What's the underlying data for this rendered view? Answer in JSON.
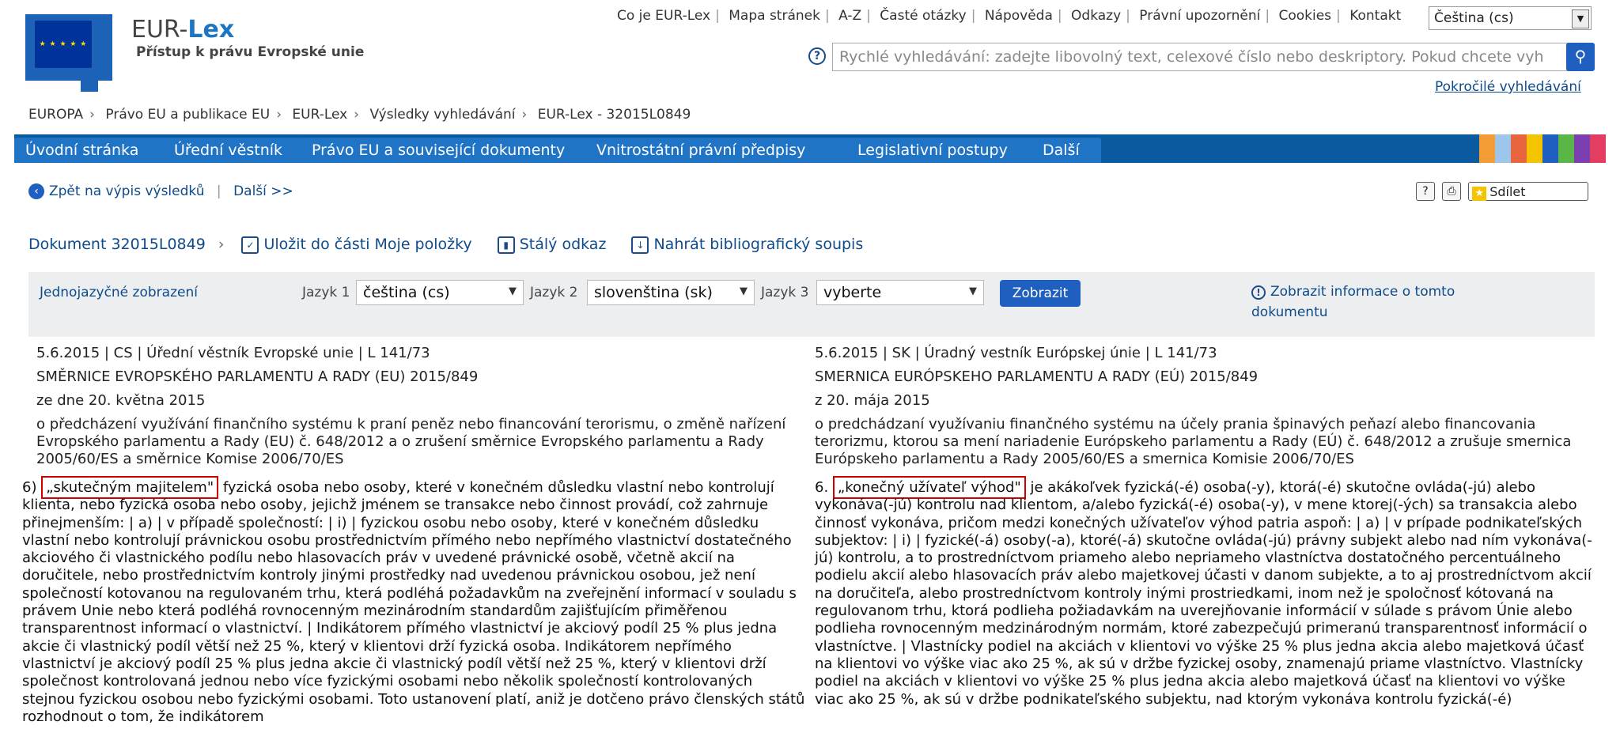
{
  "header": {
    "brand_eur": "EUR-",
    "brand_lex": "Lex",
    "subtitle": "Přístup k právu Evropské unie",
    "top_links": [
      "Co je EUR-Lex",
      "Mapa stránek",
      "A-Z",
      "Časté otázky",
      "Nápověda",
      "Odkazy",
      "Právní upozornění",
      "Cookies",
      "Kontakt"
    ],
    "language": "Čeština (cs)",
    "search_placeholder": "Rychlé vyhledávání: zadejte libovolný text, celexové číslo nebo deskriptory. Pokud chcete vyh",
    "advanced_search": "Pokročilé vyhledávání"
  },
  "breadcrumb": [
    "EUROPA",
    "Právo EU a publikace EU",
    "EUR-Lex",
    "Výsledky vyhledávání",
    "EUR-Lex - 32015L0849"
  ],
  "nav": {
    "tabs": [
      "Úvodní stránka",
      "Úřední věstník",
      "Právo EU a související dokumenty",
      "Vnitrostátní právní předpisy",
      "Legislativní postupy",
      "Další"
    ],
    "color_bars": [
      "#f39c36",
      "#9ec6ea",
      "#e8663d",
      "#f5c400",
      "#1f5fbf",
      "#5ab646",
      "#7c3fb0",
      "#e33d61"
    ]
  },
  "subnav": {
    "back": "Zpět na výpis výsledků",
    "next": "Další >>",
    "share": "Sdílet"
  },
  "doc": {
    "id": "Dokument 32015L0849",
    "save": "Uložit do části Moje položky",
    "permalink": "Stálý odkaz",
    "download_biblio": "Nahrát bibliografický soupis"
  },
  "langbar": {
    "monolingual": "Jednojazyčné zobrazení",
    "lang1_label": "Jazyk 1",
    "lang1_value": "čeština (cs)",
    "lang2_label": "Jazyk 2",
    "lang2_value": "slovenština (sk)",
    "lang3_label": "Jazyk 3",
    "lang3_value": "vyberte",
    "show": "Zobrazit",
    "info": "Zobrazit informace o tomto dokumentu"
  },
  "cs": {
    "meta": "5.6.2015   | CS | Úřední věstník Evropské unie | L 141/73",
    "title": "SMĚRNICE EVROPSKÉHO PARLAMENTU A RADY (EU) 2015/849",
    "date": "ze dne 20. května 2015",
    "subject": "o předcházení využívání finančního systému k praní peněz nebo financování terorismu, o změně nařízení Evropského parlamentu a Rady (EU) č. 648/2012 a o zrušení směrnice Evropského parlamentu a Rady 2005/60/ES a směrnice Komise 2006/70/ES",
    "body_num": "6) ",
    "body_term": "„skutečným majitelem\"",
    "body_rest": " fyzická osoba nebo osoby, které v konečném důsledku vlastní nebo kontrolují klienta, nebo fyzická osoba nebo osoby, jejichž jménem se transakce nebo činnost provádí, což zahrnuje přinejmenším: | a) | v případě společností: | i) | fyzickou osobu nebo osoby, které v konečném důsledku vlastní nebo kontrolují právnickou osobu prostřednictvím přímého nebo nepřímého vlastnictví dostatečného akciového či vlastnického podílu nebo hlasovacích práv v uvedené právnické osobě, včetně akcií na doručitele, nebo prostřednictvím kontroly jinými prostředky nad uvedenou právnickou osobou, jež není společností kotovanou na regulovaném trhu, která podléhá požadavkům na zveřejnění informací v souladu s právem Unie nebo která podléhá rovnocenným mezinárodním standardům zajišťujícím přiměřenou transparentnost informací o vlastnictví. | Indikátorem přímého vlastnictví je akciový podíl 25 % plus jedna akcie či vlastnický podíl větší než 25 %, který v klientovi drží fyzická osoba. Indikátorem nepřímého vlastnictví je akciový podíl 25 % plus jedna akcie či vlastnický podíl větší než 25 %, který v klientovi drží společnost kontrolovaná jednou nebo více fyzickými osobami nebo několik společností kontrolovaných stejnou fyzickou osobou nebo fyzickými osobami. Toto ustanovení platí, aniž je dotčeno právo členských států rozhodnout o tom, že indikátorem"
  },
  "sk": {
    "meta": "5.6.2015   | SK | Úradný vestník Európskej únie | L 141/73",
    "title": "SMERNICA EURÓPSKEHO PARLAMENTU A RADY (EÚ) 2015/849",
    "date": "z 20. mája 2015",
    "subject": "o predchádzaní využívaniu finančného systému na účely prania špinavých peňazí alebo financovania terorizmu, ktorou sa mení nariadenie Európskeho parlamentu a Rady (EÚ) č. 648/2012 a zrušuje smernica Európskeho parlamentu a Rady 2005/60/ES a smernica Komisie 2006/70/ES",
    "body_num": "6. ",
    "body_term": "„konečný užívateľ výhod\"",
    "body_rest": " je akákoľvek fyzická(-é) osoba(-y), ktorá(-é) skutočne ovláda(-jú) alebo vykonáva(-jú) kontrolu nad klientom, a/alebo fyzická(-é) osoba(-y), v mene ktorej(-ých) sa transakcia alebo činnosť vykonáva, pričom medzi konečných užívateľov výhod patria aspoň: | a) | v prípade podnikateľských subjektov: | i) | fyzické(-á) osoby(-a), ktoré(-á) skutočne ovláda(-jú) právny subjekt alebo nad ním vykonáva(-jú) kontrolu, a to prostredníctvom priameho alebo nepriameho vlastníctva dostatočného percentuálneho podielu akcií alebo hlasovacích práv alebo majetkovej účasti v danom subjekte, a to aj prostredníctvom akcií na doručiteľa, alebo prostredníctvom kontroly inými prostriedkami, inom než je spoločnosť kótovaná na regulovanom trhu, ktorá podlieha požiadavkám na uverejňovanie informácií v súlade s právom Únie alebo podlieha rovnocenným medzinárodným normám, ktoré zabezpečujú primeranú transparentnosť informácií o vlastníctve. | Vlastnícky podiel na akciách v klientovi vo výške 25 % plus jedna akcia alebo majetková účasť na klientovi vo výške viac ako 25 %, ak sú v držbe fyzickej osoby, znamenajú priame vlastníctvo. Vlastnícky podiel na akciách v klientovi vo výške 25 % plus jedna akcia alebo majetková účasť na klientovi vo výške viac ako 25 %, ak sú v držbe podnikateľského subjektu, nad ktorým vykonáva kontrolu fyzická(-é)"
  }
}
